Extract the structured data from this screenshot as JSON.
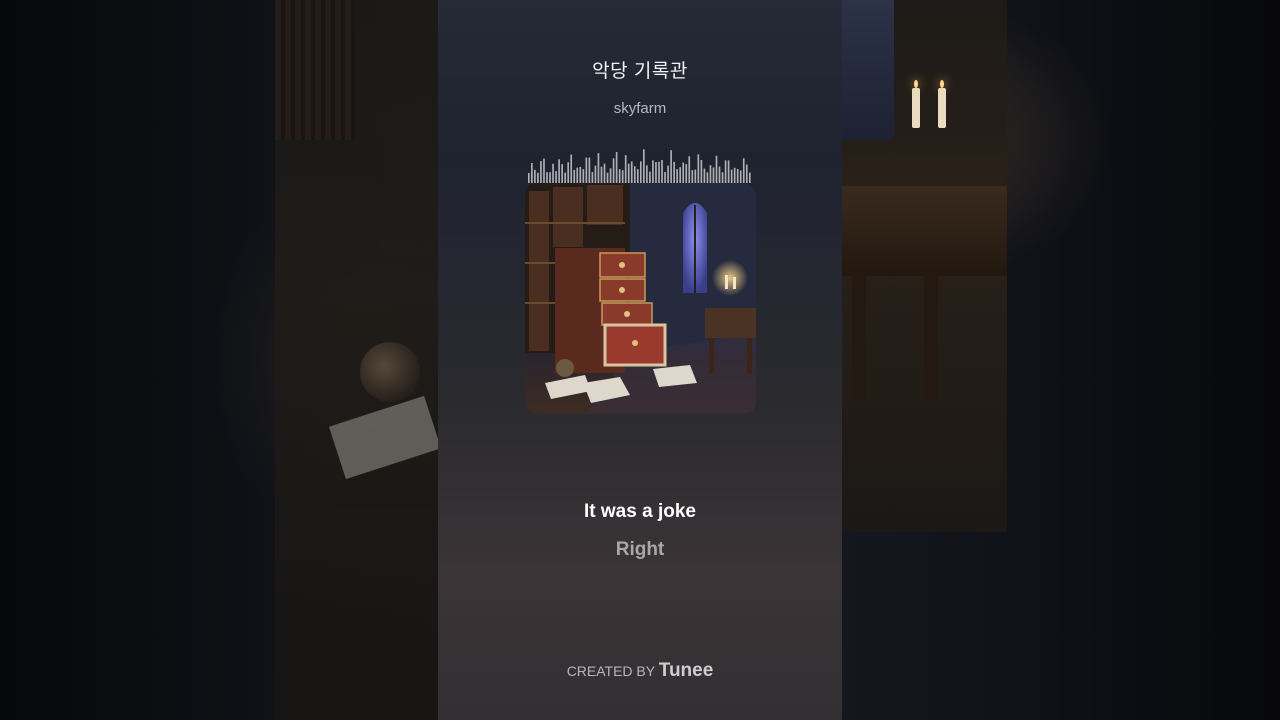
{
  "track": {
    "title": "악당 기록관",
    "artist": "skyfarm"
  },
  "cover_art": {
    "icon": "cover-art-image"
  },
  "lyrics": {
    "current": "It was a joke",
    "next": "Right"
  },
  "footer": {
    "prefix": "CREATED BY",
    "brand": "Tunee"
  },
  "colors": {
    "panel_top": "#252a36",
    "panel_bottom": "#332f33",
    "text_primary": "#ffffff",
    "text_secondary": "#a8a7a9"
  }
}
